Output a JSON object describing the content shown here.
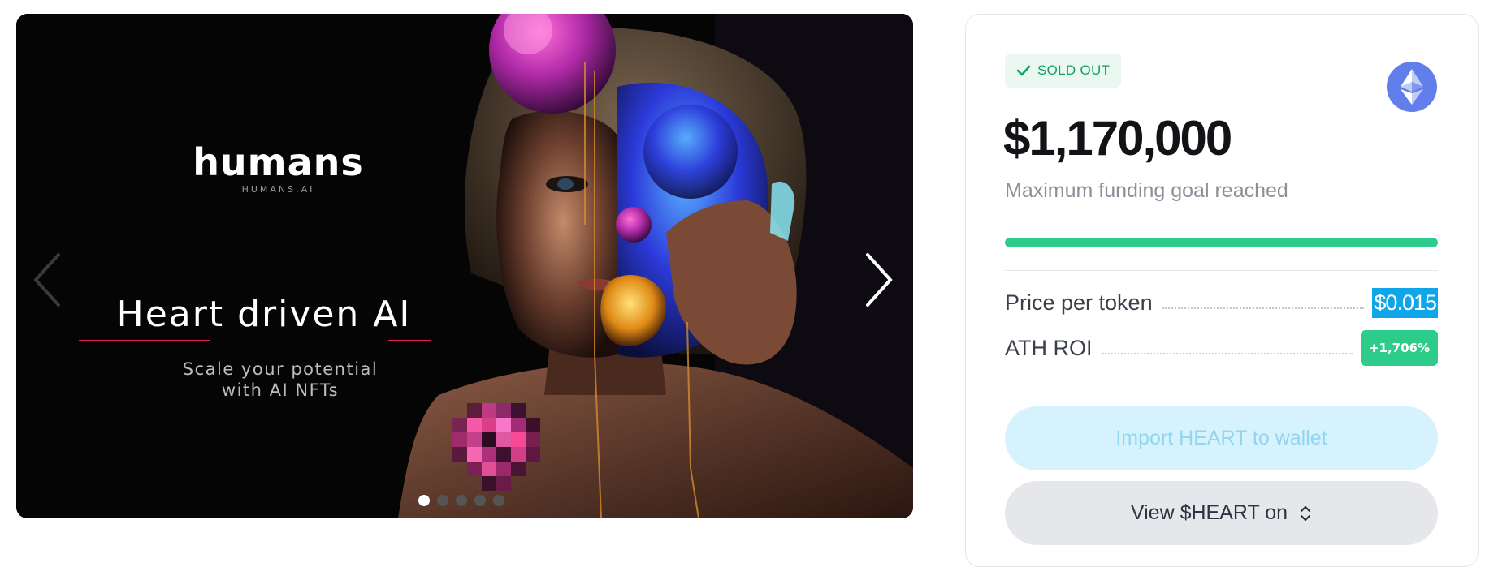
{
  "carousel": {
    "brand_logo": "humans",
    "brand_subtitle": "HUMANS.AI",
    "headline": "Heart driven AI",
    "tagline_line1": "Scale your potential",
    "tagline_line2": "with AI NFTs",
    "slide_count": 5,
    "active_slide": 1
  },
  "sale": {
    "status_badge": "SOLD OUT",
    "network_icon": "ethereum-icon",
    "amount": "$1,170,000",
    "amount_caption": "Maximum funding goal reached",
    "progress_fraction": 1.0,
    "price_label": "Price per token",
    "price_value": "$0.015",
    "roi_label": "ATH ROI",
    "roi_value": "+1,706%",
    "import_button": "Import HEART to wallet",
    "view_button": "View $HEART on"
  },
  "colors": {
    "success": "#2ecc8a",
    "badge_text": "#10a06a",
    "highlight": "#0ea5e9",
    "ethereum": "#627eea",
    "headline_underline": "#e11d5a"
  }
}
